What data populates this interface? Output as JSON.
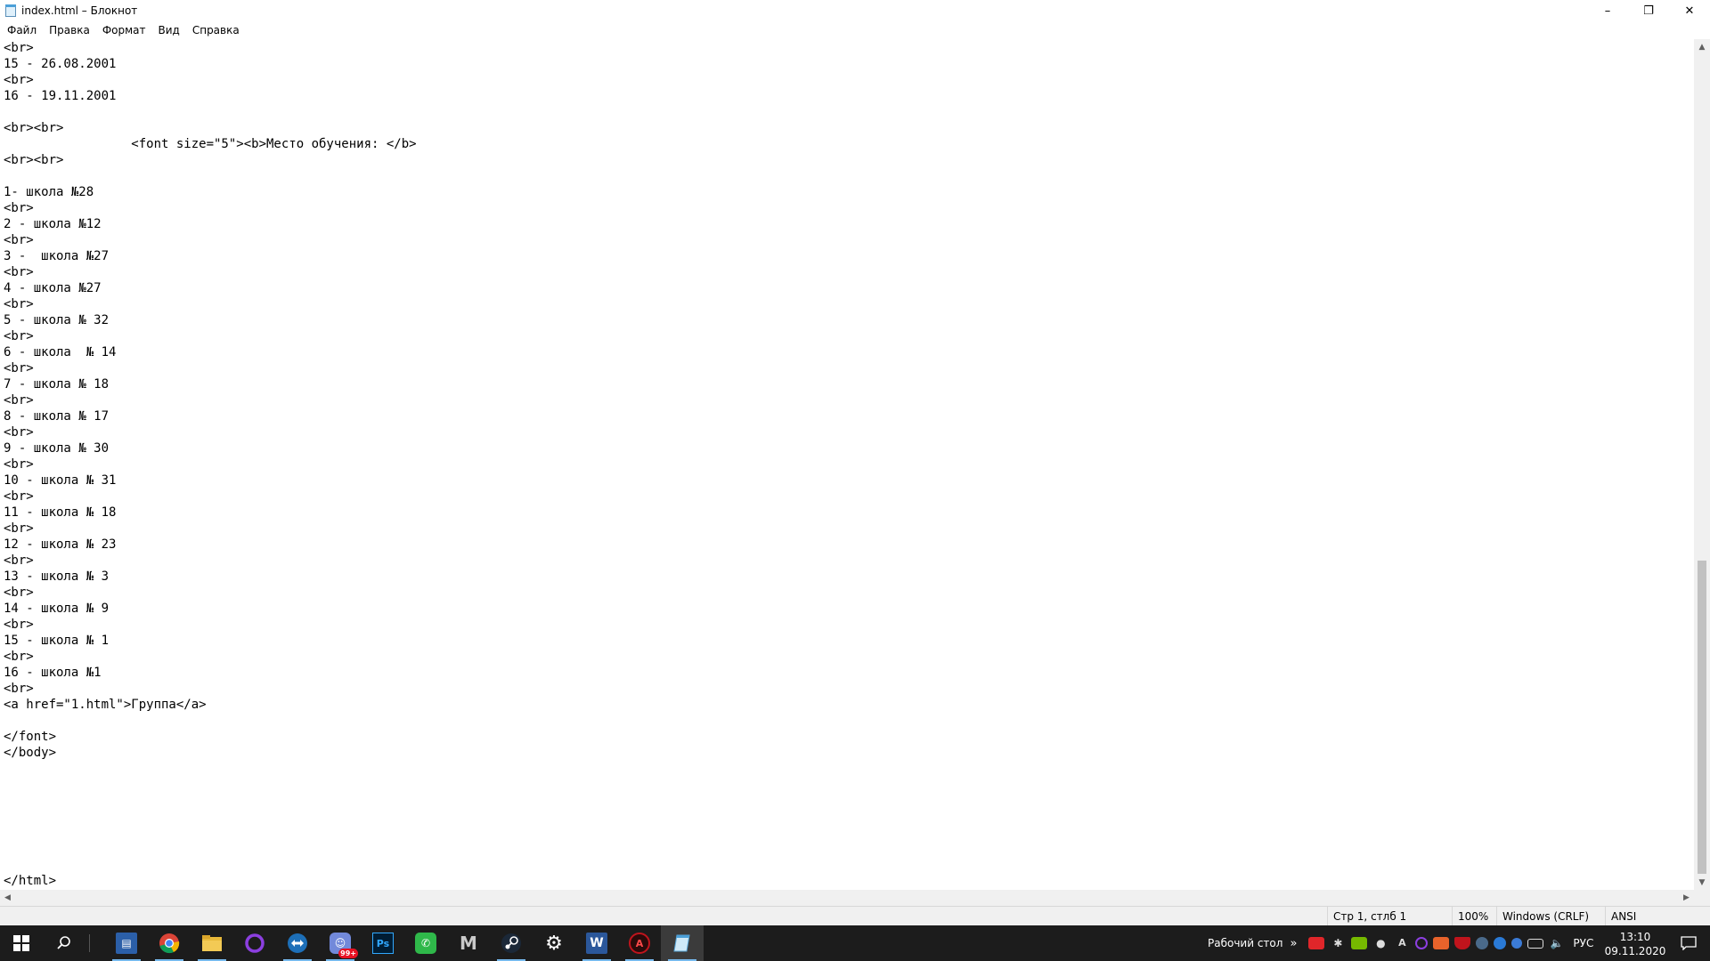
{
  "window": {
    "title": "index.html – Блокнот",
    "minimize_glyph": "–",
    "maximize_glyph": "❐",
    "close_glyph": "✕"
  },
  "menu": [
    "Файл",
    "Правка",
    "Формат",
    "Вид",
    "Справка"
  ],
  "document": {
    "lines": [
      "<br>",
      "15 - 26.08.2001",
      "<br>",
      "16 - 19.11.2001",
      "",
      "<br><br>",
      "                 <font size=\"5\"><b>Место обучения: </b>",
      "<br><br>",
      "",
      "1- школа №28",
      "<br>",
      "2 - школа №12",
      "<br>",
      "3 -  школа №27",
      "<br>",
      "4 - школа №27",
      "<br>",
      "5 - школа № 32",
      "<br>",
      "6 - школа  № 14",
      "<br>",
      "7 - школа № 18",
      "<br>",
      "8 - школа № 17",
      "<br>",
      "9 - школа № 30",
      "<br>",
      "10 - школа № 31",
      "<br>",
      "11 - школа № 18",
      "<br>",
      "12 - школа № 23",
      "<br>",
      "13 - школа № 3",
      "<br>",
      "14 - школа № 9",
      "<br>",
      "15 - школа № 1",
      "<br>",
      "16 - школа №1",
      "<br>",
      "<a href=\"1.html\">Группа</a>",
      "",
      "</font>",
      "</body>",
      "",
      "",
      "",
      "",
      "",
      "",
      "",
      "</html>"
    ]
  },
  "statusbar": {
    "position": "Стр 1, стлб 1",
    "zoom": "100%",
    "line_ending": "Windows (CRLF)",
    "encoding": "ANSI"
  },
  "taskbar": {
    "apps": [
      {
        "name": "start-button",
        "icon": "windows-logo"
      },
      {
        "name": "search-button",
        "icon": "search-icon"
      },
      {
        "name": "remote-desktop-app",
        "icon": "remote-desktop-icon",
        "running": true
      },
      {
        "name": "chrome-app",
        "icon": "chrome-icon",
        "running": true
      },
      {
        "name": "file-explorer-app",
        "icon": "folder-icon",
        "running": true
      },
      {
        "name": "cortana-app",
        "icon": "circle-icon"
      },
      {
        "name": "teamviewer-app",
        "icon": "teamviewer-icon",
        "running": true
      },
      {
        "name": "discord-app",
        "icon": "discord-icon",
        "running": true,
        "badge": "99+"
      },
      {
        "name": "photoshop-app",
        "icon": "photoshop-icon",
        "label": "Ps"
      },
      {
        "name": "phone-app",
        "icon": "phone-icon"
      },
      {
        "name": "gmail-app",
        "icon": "mail-icon",
        "label": "M"
      },
      {
        "name": "steam-app",
        "icon": "steam-icon",
        "running": true
      },
      {
        "name": "settings-app",
        "icon": "gear-icon"
      },
      {
        "name": "word-app",
        "icon": "word-icon",
        "label": "W",
        "running": true
      },
      {
        "name": "antivirus-app",
        "icon": "antivirus-icon",
        "label": "A",
        "running": true
      },
      {
        "name": "notepad-app",
        "icon": "notepad-icon",
        "running": true,
        "active": true
      }
    ],
    "desktop_label": "Рабочий стол",
    "chevron": "»",
    "language": "РУС",
    "time": "13:10",
    "date": "09.11.2020"
  }
}
